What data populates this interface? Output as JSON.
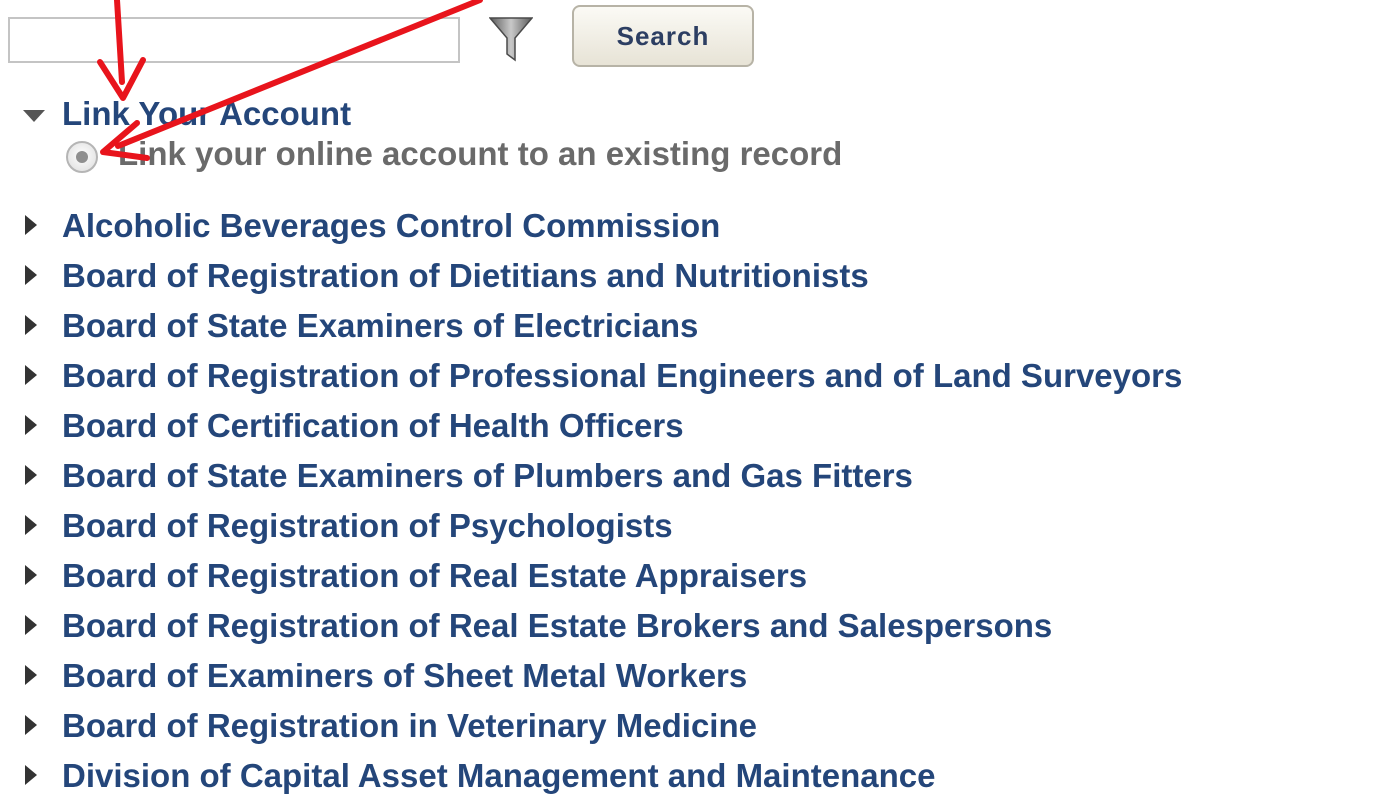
{
  "search": {
    "value": "",
    "placeholder": "",
    "filter_icon": "filter-funnel-icon",
    "button_label": "Search"
  },
  "link_section": {
    "expanded": true,
    "title": "Link Your Account",
    "option": {
      "label": "Link your online account to an existing record",
      "selected": true
    }
  },
  "agencies": [
    {
      "label": "Alcoholic Beverages Control Commission"
    },
    {
      "label": "Board of Registration of Dietitians and Nutritionists"
    },
    {
      "label": "Board of State Examiners of Electricians"
    },
    {
      "label": "Board of Registration of Professional Engineers and of Land Surveyors"
    },
    {
      "label": "Board of Certification of Health Officers"
    },
    {
      "label": "Board of State Examiners of Plumbers and Gas Fitters"
    },
    {
      "label": "Board of Registration of Psychologists"
    },
    {
      "label": "Board of Registration of Real Estate Appraisers"
    },
    {
      "label": "Board of Registration of Real Estate Brokers and Salespersons"
    },
    {
      "label": "Board of Examiners of Sheet Metal Workers"
    },
    {
      "label": "Board of Registration in Veterinary Medicine"
    },
    {
      "label": "Division of Capital Asset Management and Maintenance"
    }
  ],
  "colors": {
    "link_text": "#24467a",
    "muted_text": "#6a6a6a",
    "annotation": "#e8141c",
    "button_text": "#2c3e62"
  }
}
